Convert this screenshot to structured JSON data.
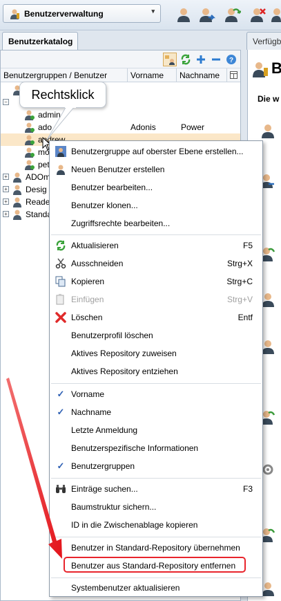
{
  "toolbar": {
    "module": "Benutzerverwaltung"
  },
  "tabs": {
    "catalog": "Benutzerkatalog",
    "right": "Verfügb"
  },
  "columns": {
    "name": "Benutzergruppen / Benutzer",
    "first": "Vorname",
    "last": "Nachname"
  },
  "tree": {
    "admin": "admin",
    "ado": "ado",
    "ado_first": "Adonis",
    "ado_last": "Power",
    "andrew": "andrew",
    "m": "mo",
    "p": "pet",
    "g1": "ADOm",
    "g2": "Desig",
    "g3": "Reade",
    "g4": "Standa"
  },
  "callout": "Rechtsklick",
  "right_panel": {
    "title": "B",
    "subtitle": "Die w"
  },
  "menu": {
    "i1": "Benutzergruppe auf oberster Ebene erstellen...",
    "i2": "Neuen Benutzer erstellen",
    "i3": "Benutzer bearbeiten...",
    "i4": "Benutzer klonen...",
    "i5": "Zugriffsrechte bearbeiten...",
    "i6": "Aktualisieren",
    "i6_sc": "F5",
    "i7": "Ausschneiden",
    "i7_sc": "Strg+X",
    "i8": "Kopieren",
    "i8_sc": "Strg+C",
    "i9": "Einfügen",
    "i9_sc": "Strg+V",
    "i10": "Löschen",
    "i10_sc": "Entf",
    "i11": "Benutzerprofil löschen",
    "i12": "Aktives Repository zuweisen",
    "i13": "Aktives Repository entziehen",
    "i14": "Vorname",
    "i15": "Nachname",
    "i16": "Letzte Anmeldung",
    "i17": "Benutzerspezifische Informationen",
    "i18": "Benutzergruppen",
    "i19": "Einträge suchen...",
    "i19_sc": "F3",
    "i20": "Baumstruktur sichern...",
    "i21": "ID in die Zwischenablage kopieren",
    "i22": "Benutzer in Standard-Repository übernehmen",
    "i23": "Benutzer aus Standard-Repository entfernen",
    "i24": "Systembenutzer aktualisieren"
  }
}
